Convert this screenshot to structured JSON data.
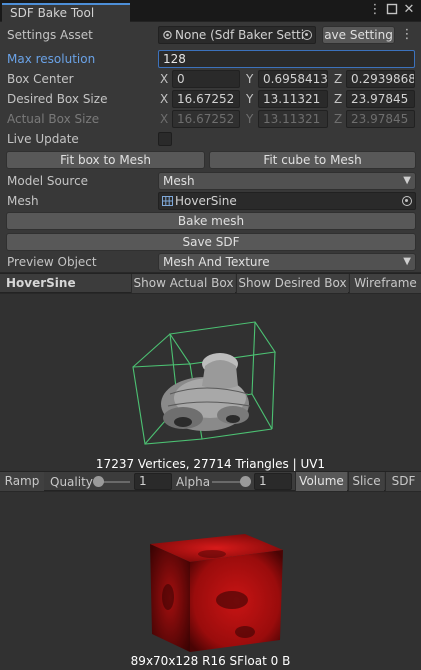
{
  "window": {
    "tab_title": "SDF Bake Tool",
    "menu_icon": "kebab-icon",
    "maximize_icon": "maximize-icon",
    "close_icon": "close-icon"
  },
  "inspector": {
    "settings_asset": {
      "label": "Settings Asset",
      "value": "None (Sdf Baker Setti",
      "save_button": "ave Setting"
    },
    "max_resolution": {
      "label": "Max resolution",
      "value": "128"
    },
    "box_center": {
      "label": "Box Center",
      "x": "0",
      "y": "0.6958413",
      "z": "0.2939868"
    },
    "desired_box_size": {
      "label": "Desired Box Size",
      "x": "16.67252",
      "y": "13.11321",
      "z": "23.97845"
    },
    "actual_box_size": {
      "label": "Actual Box Size",
      "x": "16.67252",
      "y": "13.11321",
      "z": "23.97845"
    },
    "axis_labels": {
      "x": "X",
      "y": "Y",
      "z": "Z"
    },
    "live_update": {
      "label": "Live Update",
      "checked": false
    },
    "fit_box_button": "Fit box to Mesh",
    "fit_cube_button": "Fit cube to Mesh",
    "model_source": {
      "label": "Model Source",
      "value": "Mesh"
    },
    "mesh": {
      "label": "Mesh",
      "value": "HoverSine"
    },
    "bake_mesh_button": "Bake mesh",
    "save_sdf_button": "Save SDF",
    "preview_object": {
      "label": "Preview Object",
      "value": "Mesh And Texture"
    }
  },
  "mesh_toolbar": {
    "title": "HoverSine",
    "show_actual_box": "Show Actual Box",
    "show_desired_box": "Show Desired Box",
    "wireframe": "Wireframe"
  },
  "mesh_preview": {
    "caption": "17237 Vertices, 27714 Triangles | UV1",
    "box_color": "#4fd17a"
  },
  "sdf_toolbar": {
    "ramp": "Ramp",
    "quality_label": "Quality",
    "quality_value": "1",
    "alpha_label": "Alpha",
    "alpha_value": "1",
    "volume": "Volume",
    "slice": "Slice",
    "sdf": "SDF"
  },
  "sdf_preview": {
    "caption": "89x70x128 R16 SFloat 0 B",
    "cube_color": "#b01212"
  }
}
